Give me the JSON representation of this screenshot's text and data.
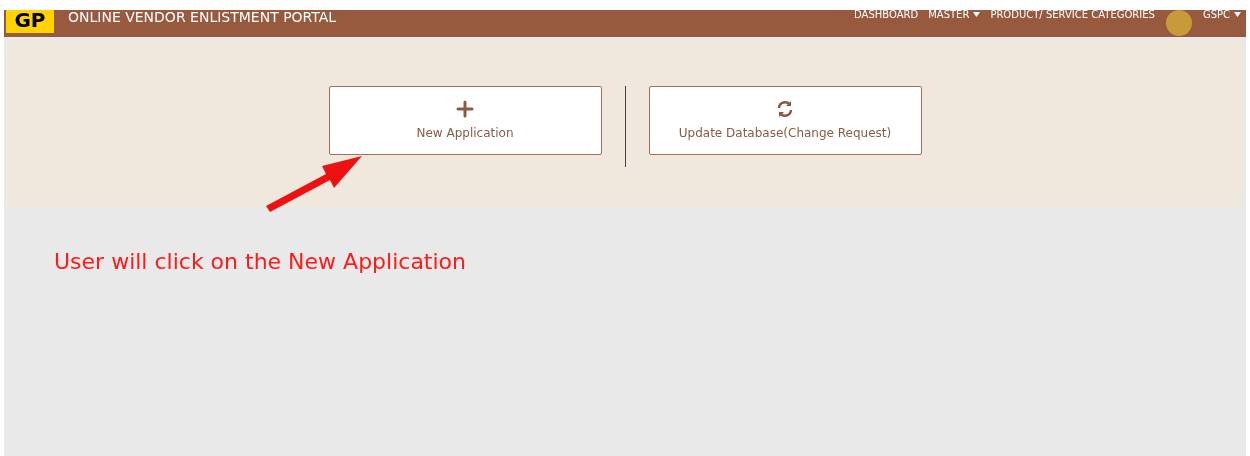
{
  "header": {
    "logo": "GP",
    "title": "ONLINE VENDOR ENLISTMENT PORTAL",
    "nav": [
      {
        "label": "DASHBOARD",
        "dropdown": false
      },
      {
        "label": "MASTER",
        "dropdown": true
      },
      {
        "label": "PRODUCT/ SERVICE CATEGORIES",
        "dropdown": false
      }
    ],
    "user": {
      "name": "GSPC",
      "dropdown": true
    }
  },
  "actions": [
    {
      "kind": "add",
      "label": "New Application"
    },
    {
      "kind": "refresh",
      "label": "Update Database(Change Request)"
    }
  ],
  "annotation": {
    "text": "User will click on the New Application"
  }
}
